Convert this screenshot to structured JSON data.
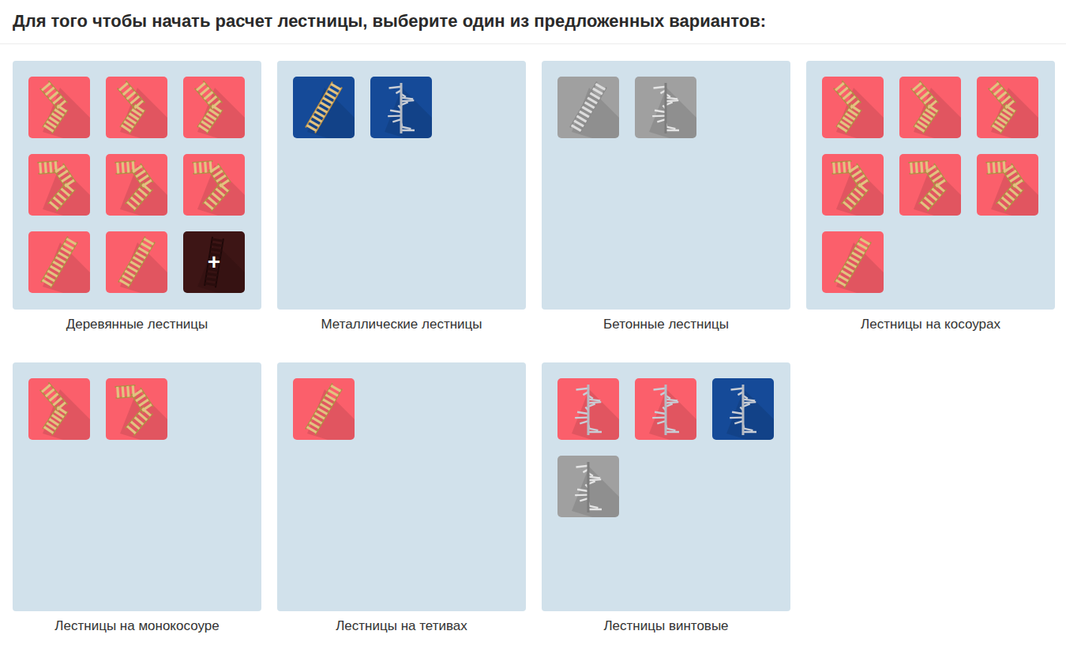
{
  "heading": "Для того чтобы начать расчет лестницы, выберите один из предложенных вариантов:",
  "groups": [
    {
      "title": "Деревянные лестницы",
      "items": [
        {
          "kind": "turn",
          "color": "#fb5f6b"
        },
        {
          "kind": "turn",
          "color": "#fb5f6b"
        },
        {
          "kind": "turn",
          "color": "#fb5f6b"
        },
        {
          "kind": "u-turn",
          "color": "#fb5f6b"
        },
        {
          "kind": "u-turn",
          "color": "#fb5f6b"
        },
        {
          "kind": "u-turn",
          "color": "#fb5f6b"
        },
        {
          "kind": "straight",
          "color": "#fb5f6b"
        },
        {
          "kind": "straight",
          "color": "#fb5f6b"
        },
        {
          "kind": "add",
          "color": "#3d1515",
          "label": "+"
        }
      ]
    },
    {
      "title": "Металлические лестницы",
      "items": [
        {
          "kind": "straight",
          "color": "#154a98"
        },
        {
          "kind": "spiral",
          "color": "#154a98"
        }
      ]
    },
    {
      "title": "Бетонные лестницы",
      "items": [
        {
          "kind": "straight",
          "color": "#a0a0a0"
        },
        {
          "kind": "spiral",
          "color": "#a0a0a0"
        }
      ]
    },
    {
      "title": "Лестницы на косоурах",
      "items": [
        {
          "kind": "turn",
          "color": "#fb5f6b"
        },
        {
          "kind": "turn",
          "color": "#fb5f6b"
        },
        {
          "kind": "turn",
          "color": "#fb5f6b"
        },
        {
          "kind": "u-turn",
          "color": "#fb5f6b"
        },
        {
          "kind": "u-turn",
          "color": "#fb5f6b"
        },
        {
          "kind": "u-turn",
          "color": "#fb5f6b"
        },
        {
          "kind": "straight",
          "color": "#fb5f6b"
        }
      ]
    },
    {
      "title": "Лестницы на монокосоуре",
      "items": [
        {
          "kind": "turn",
          "color": "#fb5f6b"
        },
        {
          "kind": "u-turn",
          "color": "#fb5f6b"
        }
      ]
    },
    {
      "title": "Лестницы на тетивах",
      "items": [
        {
          "kind": "straight",
          "color": "#fb5f6b"
        }
      ]
    },
    {
      "title": "Лестницы винтовые",
      "items": [
        {
          "kind": "spiral",
          "color": "#fb5f6b"
        },
        {
          "kind": "spiral",
          "color": "#fb5f6b"
        },
        {
          "kind": "spiral",
          "color": "#154a98"
        },
        {
          "kind": "spiral",
          "color": "#a0a0a0"
        }
      ]
    }
  ]
}
